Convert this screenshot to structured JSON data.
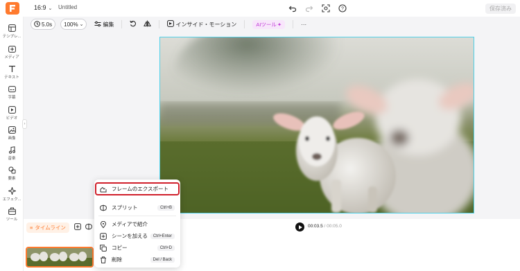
{
  "header": {
    "aspect_ratio": "16:9",
    "title": "Untitled",
    "save_label": "保存済み",
    "icons": [
      "undo-icon",
      "redo-icon",
      "screenshot-icon",
      "help-icon"
    ]
  },
  "sidebar": {
    "items": [
      {
        "label": "テンプレ...",
        "icon": "template-icon"
      },
      {
        "label": "メディア",
        "icon": "media-icon"
      },
      {
        "label": "テキスト",
        "icon": "text-icon"
      },
      {
        "label": "字幕",
        "icon": "subtitle-icon"
      },
      {
        "label": "ビデオ",
        "icon": "video-icon"
      },
      {
        "label": "画像",
        "icon": "image-icon"
      },
      {
        "label": "音楽",
        "icon": "music-icon"
      },
      {
        "label": "要素",
        "icon": "elements-icon"
      },
      {
        "label": "エフェク...",
        "icon": "effects-icon"
      },
      {
        "label": "ツール",
        "icon": "tools-icon"
      }
    ]
  },
  "toolbar": {
    "duration": "5.0s",
    "zoom": "100%",
    "edit_label": "編集",
    "animation_label": "インサイド・モーション",
    "ai_label": "AIツール",
    "more_label": "···"
  },
  "timeline": {
    "label": "タイムライン",
    "current_time": "00:03.5",
    "total_time": "00:05.0"
  },
  "context_menu": {
    "items": [
      {
        "label": "フレームのエクスポート",
        "shortcut": "",
        "icon": "export-frame-icon",
        "highlighted": true
      },
      {
        "label": "スプリット",
        "shortcut": "Ctrl+B",
        "icon": "split-icon"
      },
      {
        "label": "メディアで紹介",
        "shortcut": "",
        "icon": "location-icon"
      },
      {
        "label": "シーンを加える",
        "shortcut": "Ctrl+Enter",
        "icon": "add-scene-icon"
      },
      {
        "label": "コピー",
        "shortcut": "Ctrl+D",
        "icon": "copy-icon"
      },
      {
        "label": "削除",
        "shortcut": "Del / Back",
        "icon": "trash-icon"
      }
    ]
  },
  "colors": {
    "brand": "#ff7a2e",
    "canvas_border": "#4fd0e8",
    "highlight_border": "#d01f2a",
    "ai_accent": "#c03ad6"
  }
}
